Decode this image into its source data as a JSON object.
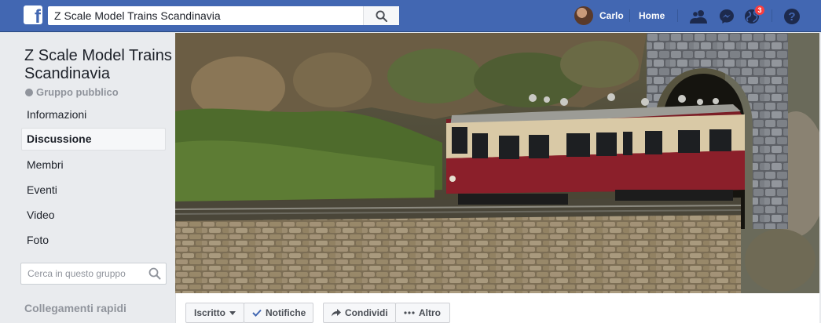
{
  "topbar": {
    "search_value": "Z Scale Model Trains Scandinavia",
    "user_name": "Carlo",
    "home_label": "Home",
    "notifications_count": "3",
    "help_label": "?"
  },
  "group": {
    "title": "Z Scale Model Trains Scandinavia",
    "privacy": "Gruppo pubblico"
  },
  "sidebar": {
    "items": [
      {
        "label": "Informazioni"
      },
      {
        "label": "Discussione"
      },
      {
        "label": "Membri"
      },
      {
        "label": "Eventi"
      },
      {
        "label": "Video"
      },
      {
        "label": "Foto"
      }
    ],
    "search_placeholder": "Cerca in questo gruppo",
    "quick_links_label": "Collegamenti rapidi"
  },
  "actions": {
    "joined_label": "Iscritto",
    "notifications_label": "Notifiche",
    "share_label": "Condividi",
    "more_label": "Altro"
  },
  "colors": {
    "brand": "#4267b2",
    "background": "#e9ebee",
    "badge": "#fa3e3e",
    "check": "#4267b2"
  }
}
